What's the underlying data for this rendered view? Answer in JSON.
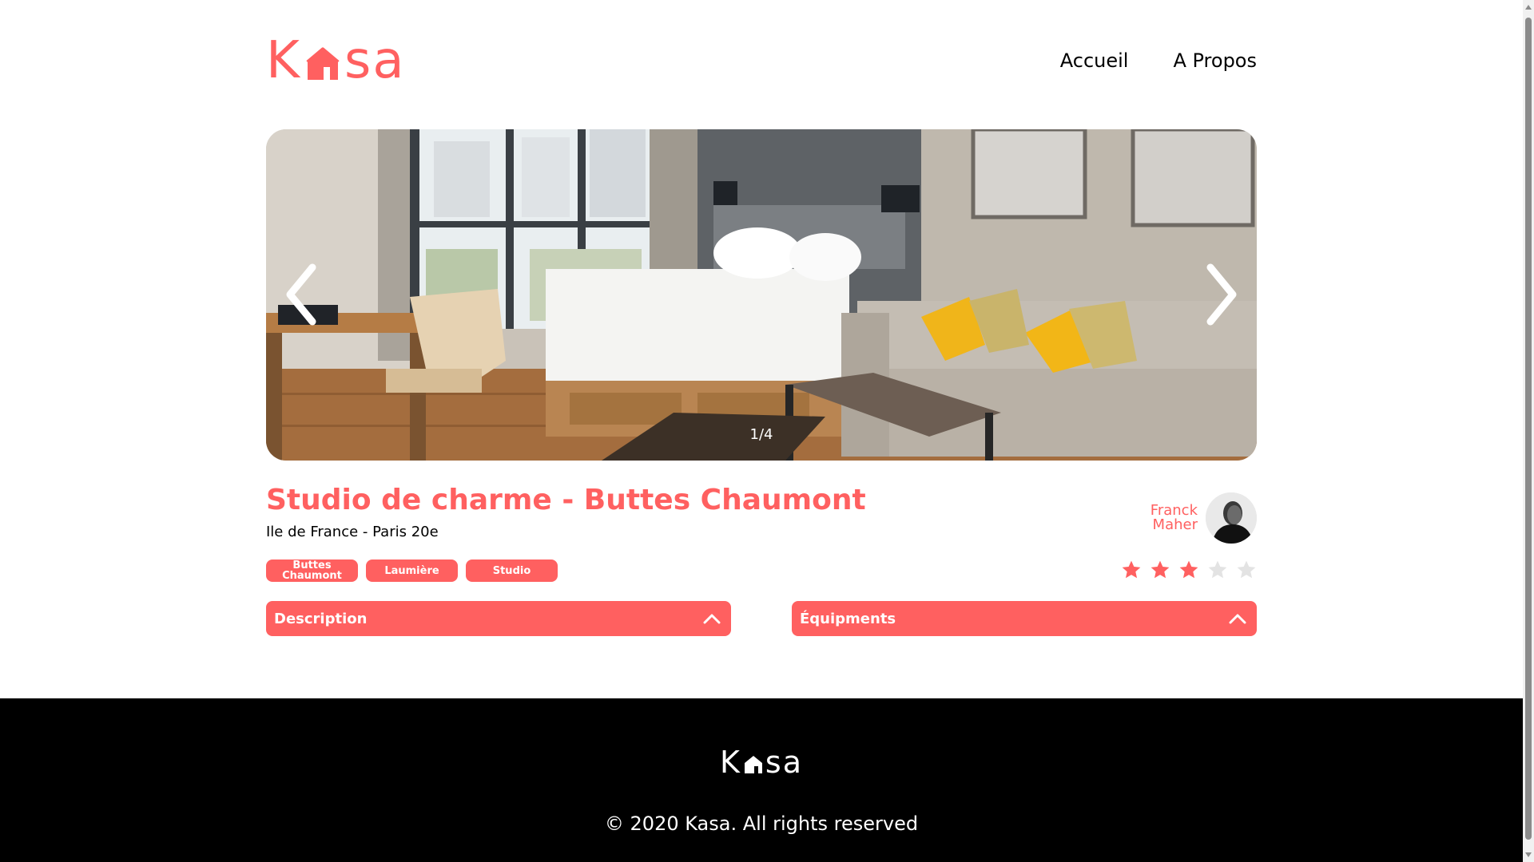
{
  "brand": {
    "logo_text_start": "K",
    "logo_text_end": "sa",
    "color": "#ff6060"
  },
  "nav": {
    "items": [
      {
        "label": "Accueil"
      },
      {
        "label": "A Propos"
      }
    ]
  },
  "gallery": {
    "counter": "1/4",
    "prev_icon": "chevron-left-icon",
    "next_icon": "chevron-right-icon"
  },
  "listing": {
    "title": "Studio de charme - Buttes Chaumont",
    "location": "Ile de France - Paris 20e",
    "tags": [
      "Buttes Chaumont",
      "Laumière",
      "Studio"
    ],
    "host": {
      "first_name": "Franck",
      "last_name": "Maher"
    },
    "rating": {
      "value": 3,
      "max": 5
    }
  },
  "collapses": [
    {
      "label": "Description",
      "icon": "chevron-up-icon"
    },
    {
      "label": "Équipments",
      "icon": "chevron-up-icon"
    }
  ],
  "footer": {
    "logo_text_start": "K",
    "logo_text_end": "sa",
    "copyright": "© 2020 Kasa. All rights reserved"
  },
  "colors": {
    "accent": "#ff6060",
    "star_off": "#e3e3e3",
    "footer_bg": "#000000"
  }
}
